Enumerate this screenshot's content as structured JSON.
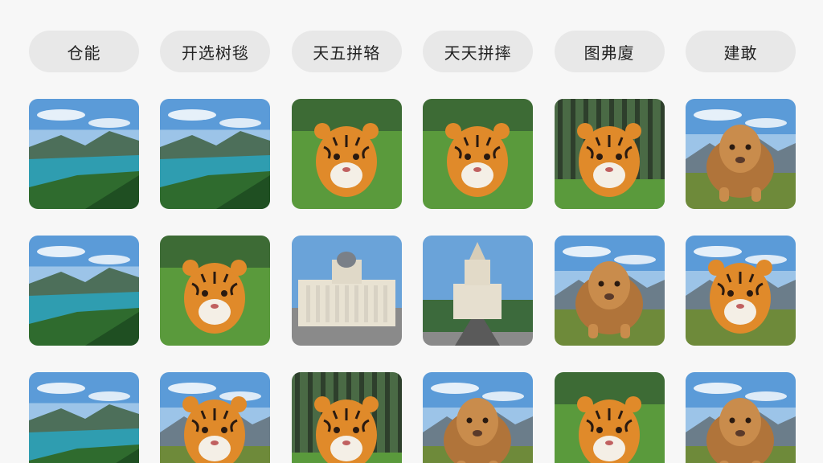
{
  "filters": [
    {
      "label": "仓能"
    },
    {
      "label": "开选树毯"
    },
    {
      "label": "天五拼辂"
    },
    {
      "label": "天天拼摔"
    },
    {
      "label": "图弗廈"
    },
    {
      "label": "建敢"
    }
  ],
  "gallery": {
    "tiles": [
      {
        "subject": "lake-landscape",
        "scene": "lake"
      },
      {
        "subject": "lake-landscape",
        "scene": "lake"
      },
      {
        "subject": "tiger",
        "scene": "grass"
      },
      {
        "subject": "tiger",
        "scene": "grass"
      },
      {
        "subject": "tiger",
        "scene": "forest"
      },
      {
        "subject": "lion",
        "scene": "mountain"
      },
      {
        "subject": "lake-landscape",
        "scene": "lake"
      },
      {
        "subject": "tiger",
        "scene": "grass"
      },
      {
        "subject": "palace-building",
        "scene": "building"
      },
      {
        "subject": "tower-building",
        "scene": "building"
      },
      {
        "subject": "lion",
        "scene": "mountain"
      },
      {
        "subject": "tiger",
        "scene": "mountain"
      },
      {
        "subject": "lake-landscape",
        "scene": "lake"
      },
      {
        "subject": "tiger",
        "scene": "mountain"
      },
      {
        "subject": "tiger",
        "scene": "forest"
      },
      {
        "subject": "lion",
        "scene": "mountain"
      },
      {
        "subject": "tiger",
        "scene": "grass"
      },
      {
        "subject": "lion",
        "scene": "mountain"
      }
    ]
  },
  "colors": {
    "background": "#f7f7f7",
    "chip_bg": "#e8e8e8",
    "chip_text": "#222222"
  }
}
